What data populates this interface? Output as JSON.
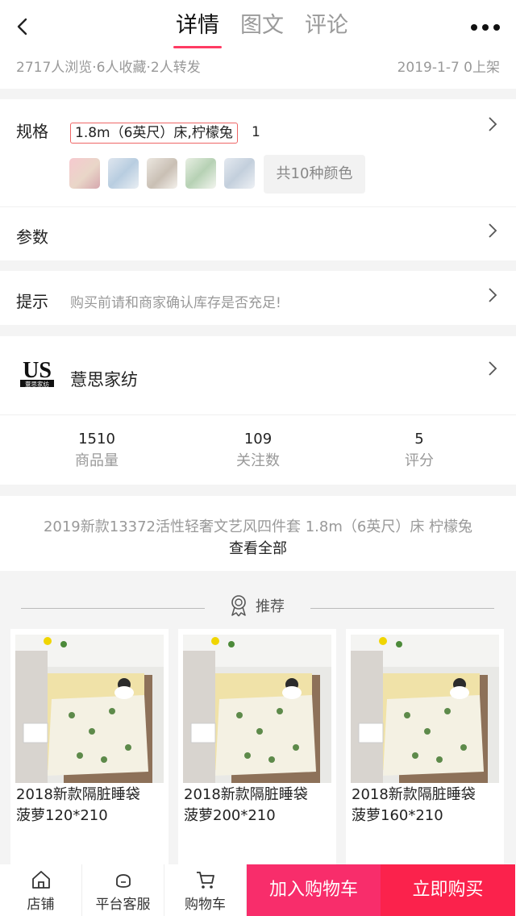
{
  "header": {
    "tabs": [
      {
        "label": "详情",
        "active": true
      },
      {
        "label": "图文",
        "active": false
      },
      {
        "label": "评论",
        "active": false
      }
    ],
    "stats": "2717人浏览·6人收藏·2人转发",
    "date": "2019-1-7 0上架",
    "back_icon": "back-chevron-icon",
    "more_icon": "more-dots-icon"
  },
  "spec": {
    "label": "规格",
    "selected": "1.8m（6英尺）床,柠檬兔",
    "quantity": "1",
    "colors_button": "共10种颜色",
    "swatch_count": 5
  },
  "params": {
    "label": "参数"
  },
  "tip": {
    "label": "提示",
    "text": "购买前请和商家确认库存是否充足!"
  },
  "store": {
    "logo_text": "US",
    "logo_sub": "薏思家纺",
    "name": "薏思家纺",
    "metrics": [
      {
        "value": "1510",
        "label": "商品量"
      },
      {
        "value": "109",
        "label": "关注数"
      },
      {
        "value": "5",
        "label": "评分"
      }
    ]
  },
  "description": {
    "title": "2019新款13372活性轻奢文艺风四件套 1.8m（6英尺）床 柠檬兔",
    "view_all": "查看全部"
  },
  "recommend": {
    "title": "推荐",
    "products": [
      {
        "title_line1": "2018新款隔脏睡袋",
        "title_line2": "菠萝120*210"
      },
      {
        "title_line1": "2018新款隔脏睡袋",
        "title_line2": "菠萝200*210"
      },
      {
        "title_line1": "2018新款隔脏睡袋",
        "title_line2": "菠萝160*210"
      }
    ]
  },
  "bottom_bar": {
    "store": "店铺",
    "service": "平台客服",
    "cart": "购物车",
    "add_to_cart": "加入购物车",
    "buy_now": "立即购买"
  },
  "colors": {
    "accent": "#ff3b63",
    "cart_button": "#f82d6b",
    "buy_button": "#fb224c"
  }
}
